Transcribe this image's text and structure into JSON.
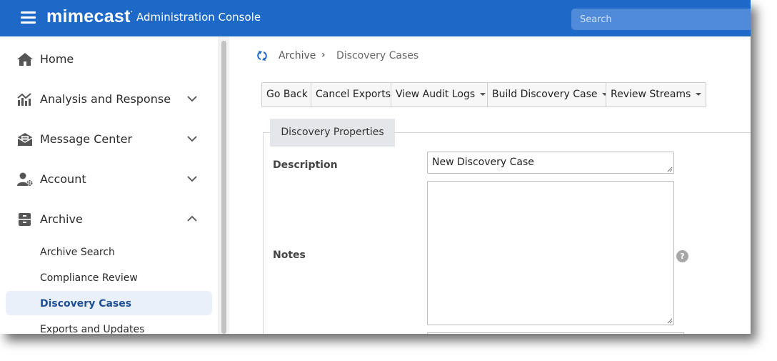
{
  "header": {
    "logo_text": "mimecast",
    "logo_mark": ".",
    "app_title": "Administration Console",
    "search_placeholder": "Search"
  },
  "sidebar": {
    "items": [
      {
        "label": "Home",
        "icon": "home-icon"
      },
      {
        "label": "Analysis and Response",
        "icon": "chart-icon",
        "expanded": false
      },
      {
        "label": "Message Center",
        "icon": "mail-icon",
        "expanded": false
      },
      {
        "label": "Account",
        "icon": "user-gear-icon",
        "expanded": false
      },
      {
        "label": "Archive",
        "icon": "archive-box-icon",
        "expanded": true
      }
    ],
    "archive_subitems": [
      {
        "label": "Archive Search",
        "active": false
      },
      {
        "label": "Compliance Review",
        "active": false
      },
      {
        "label": "Discovery Cases",
        "active": true
      },
      {
        "label": "Exports and Updates",
        "active": false
      }
    ]
  },
  "breadcrumb": {
    "root": "Archive",
    "separator": "›",
    "current": "Discovery Cases"
  },
  "toolbar": {
    "go_back": "Go Back",
    "cancel_exports": "Cancel Exports",
    "view_audit_logs": "View Audit Logs",
    "build_discovery_case": "Build Discovery Case",
    "review_streams": "Review Streams"
  },
  "form": {
    "tab_label": "Discovery Properties",
    "description_label": "Description",
    "description_value": "New Discovery Case",
    "notes_label": "Notes",
    "notes_value": "",
    "help_glyph": "?"
  },
  "colors": {
    "topbar": "#1e69c8",
    "active_nav_bg": "#e9f0fa",
    "active_nav_text": "#1f4f96"
  }
}
